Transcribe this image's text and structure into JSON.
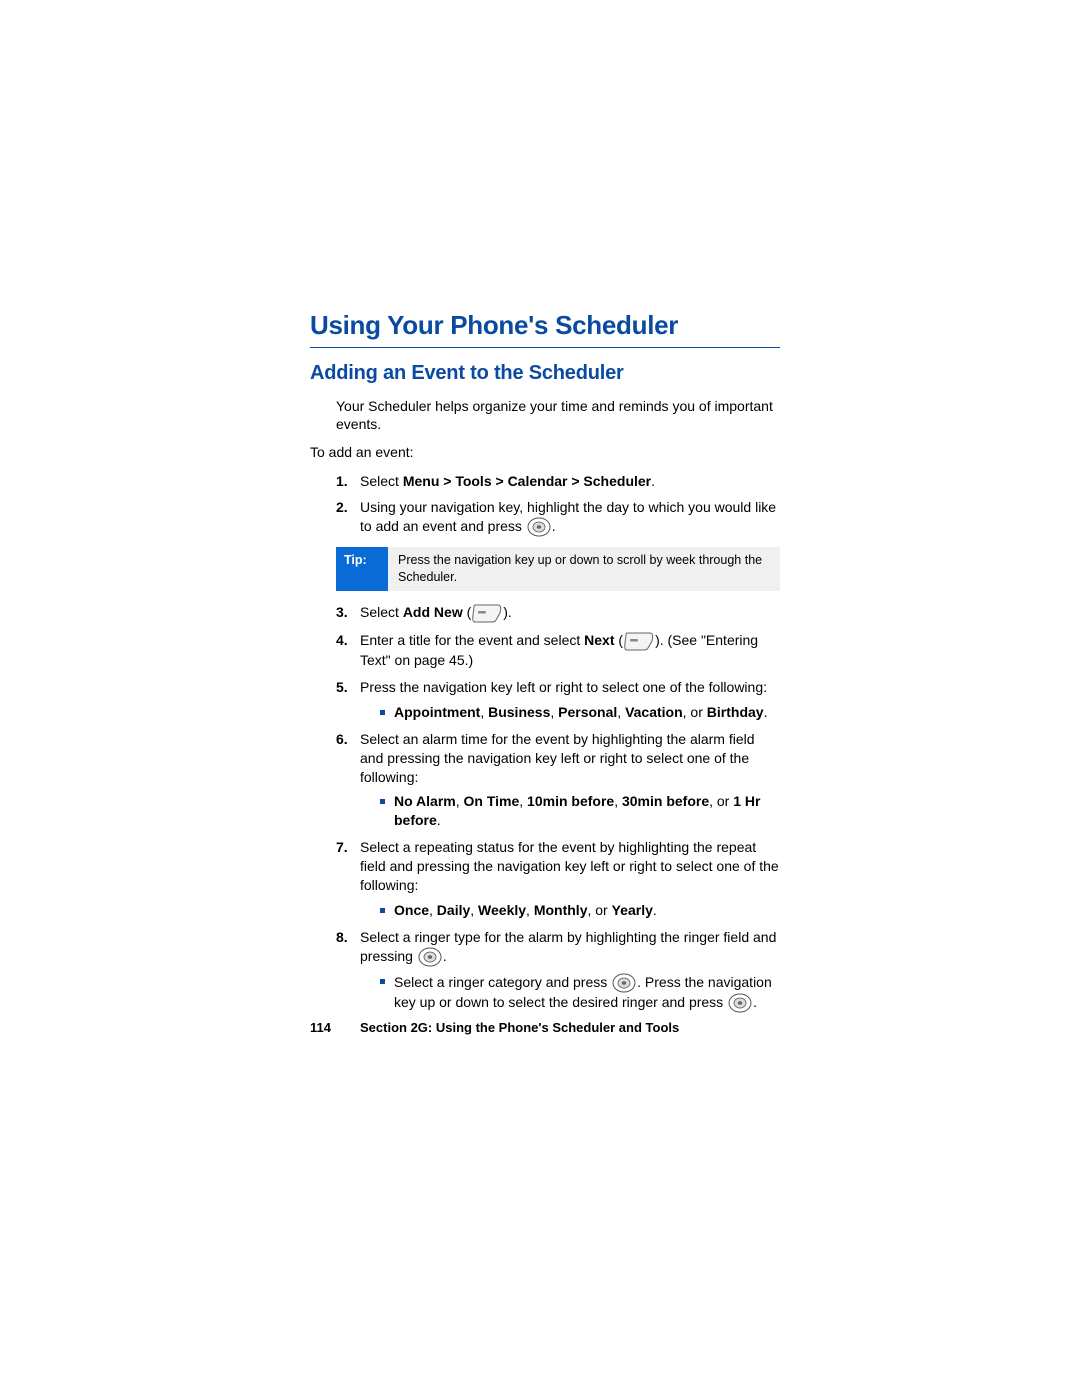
{
  "title": "Using Your Phone's Scheduler",
  "subtitle": "Adding an Event to the Scheduler",
  "intro": "Your Scheduler helps organize your time and reminds you of important events.",
  "lead": "To add an event:",
  "steps": {
    "s1_pre": "Select ",
    "s1_bold": "Menu > Tools > Calendar > Scheduler",
    "s1_post": ".",
    "s2_pre": "Using your navigation key, highlight the day to which you would like to add an event and press ",
    "s2_post": ".",
    "s3_pre": "Select ",
    "s3_bold": "Add New",
    "s3_post_open": " (",
    "s3_post_close": ").",
    "s4_pre": "Enter a title for the event and select ",
    "s4_bold": "Next",
    "s4_post_open": " (",
    "s4_post_close": "). (See \"Entering Text\" on page 45.)",
    "s5": "Press the navigation key left or right to select one of the following:",
    "s5_opt_a": "Appointment",
    "s5_opt_b": "Business",
    "s5_opt_c": "Personal",
    "s5_opt_d": "Vacation",
    "s5_or": ", or ",
    "s5_opt_e": "Birthday",
    "s5_end": ".",
    "s6": "Select an alarm time for the event by highlighting the alarm field and pressing the navigation key left or right to select one of the following:",
    "s6_opt_a": "No Alarm",
    "s6_opt_b": "On Time",
    "s6_opt_c": "10min before",
    "s6_opt_d": "30min before",
    "s6_or": ", or ",
    "s6_opt_e": "1 Hr before",
    "s6_end": ".",
    "s7": "Select a repeating status for the event by highlighting the repeat field and pressing the navigation key left or right to select one of the following:",
    "s7_opt_a": "Once",
    "s7_opt_b": "Daily",
    "s7_opt_c": "Weekly",
    "s7_opt_d": "Monthly",
    "s7_or": ", or ",
    "s7_opt_e": "Yearly",
    "s7_end": ".",
    "s8_pre": "Select a ringer type for the alarm by highlighting the ringer field and pressing ",
    "s8_post": ".",
    "s8_sub_pre": "Select a ringer category and press ",
    "s8_sub_mid": ". Press the navigation key up or down to select the desired ringer and press ",
    "s8_sub_post": "."
  },
  "tip": {
    "label": "Tip:",
    "text": "Press the navigation key up or down to scroll by week through the Scheduler."
  },
  "comma": ", ",
  "footer": {
    "page": "114",
    "section": "Section 2G: Using the Phone's Scheduler and Tools"
  }
}
